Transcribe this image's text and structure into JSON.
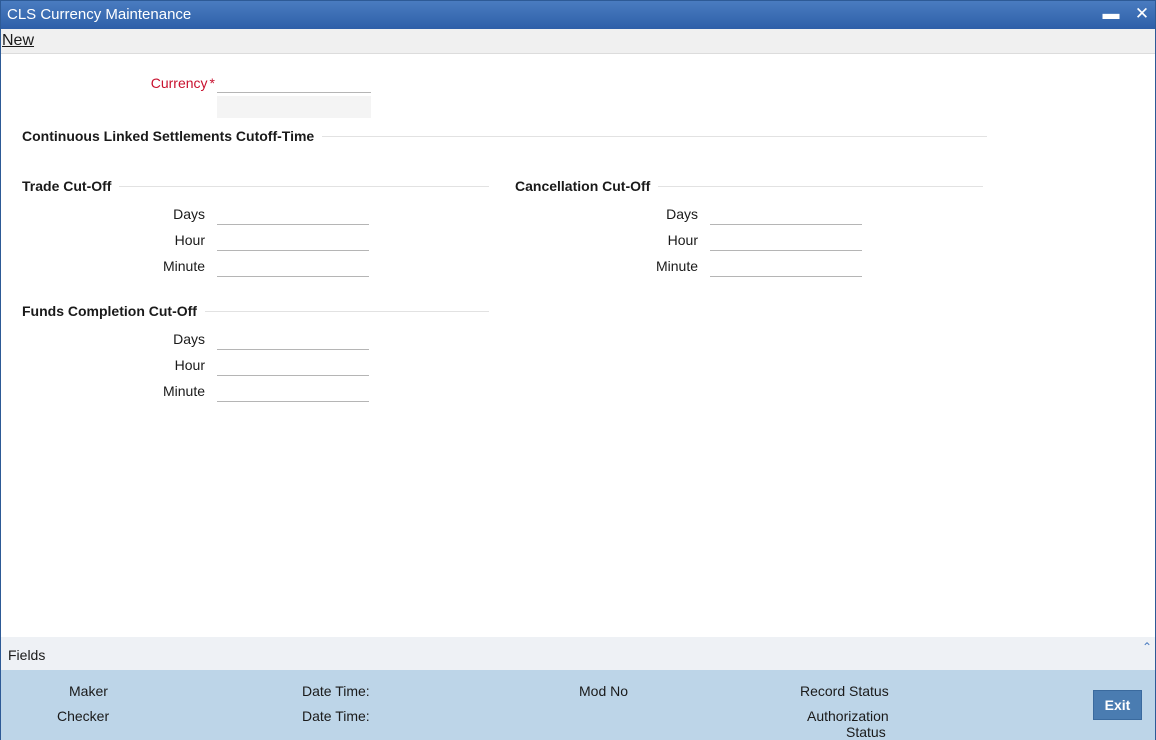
{
  "window": {
    "title": "CLS Currency Maintenance",
    "minimize_glyph": "▬",
    "close_glyph": "✕"
  },
  "menu": {
    "new_label": "New"
  },
  "currency": {
    "label": "Currency",
    "required_mark": "*",
    "value": "",
    "description": ""
  },
  "main_section": {
    "title": "Continuous Linked Settlements Cutoff-Time"
  },
  "trade_cutoff": {
    "title": "Trade Cut-Off",
    "days_label": "Days",
    "hour_label": "Hour",
    "minute_label": "Minute",
    "days": "",
    "hour": "",
    "minute": ""
  },
  "cancellation_cutoff": {
    "title": "Cancellation Cut-Off",
    "days_label": "Days",
    "hour_label": "Hour",
    "minute_label": "Minute",
    "days": "",
    "hour": "",
    "minute": ""
  },
  "funds_completion_cutoff": {
    "title": "Funds Completion Cut-Off",
    "days_label": "Days",
    "hour_label": "Hour",
    "minute_label": "Minute",
    "days": "",
    "hour": "",
    "minute": ""
  },
  "fields_bar": {
    "label": "Fields",
    "collapse_icon": "chevron-up-icon",
    "collapse_glyph": "⌃"
  },
  "audit": {
    "maker_label": "Maker",
    "checker_label": "Checker",
    "date_time_label_1": "Date Time:",
    "date_time_label_2": "Date Time:",
    "mod_no_label": "Mod No",
    "record_status_label": "Record Status",
    "authorization_status_label_1": "Authorization",
    "authorization_status_label_2": "Status"
  },
  "buttons": {
    "exit_label": "Exit"
  },
  "colors": {
    "titlebar": "#2e5fa8",
    "required": "#c8102e",
    "audit_bg": "#bdd5e8",
    "exit_button": "#4a7cb1"
  }
}
